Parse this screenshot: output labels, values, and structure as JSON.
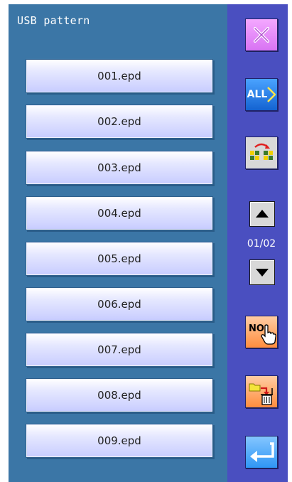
{
  "title": "USB pattern",
  "files": [
    {
      "label": "001.epd"
    },
    {
      "label": "002.epd"
    },
    {
      "label": "003.epd"
    },
    {
      "label": "004.epd"
    },
    {
      "label": "005.epd"
    },
    {
      "label": "006.epd"
    },
    {
      "label": "007.epd"
    },
    {
      "label": "008.epd"
    },
    {
      "label": "009.epd"
    }
  ],
  "pagination": {
    "indicator": "01/02"
  },
  "sidebar": {
    "all_label": "ALL",
    "no_label": "NO.",
    "buttons": [
      {
        "name": "close",
        "icon": "close-icon"
      },
      {
        "name": "select-all",
        "icon": "all-icon"
      },
      {
        "name": "swap-view",
        "icon": "grid-swap-icon"
      },
      {
        "name": "page-up",
        "icon": "triangle-up-icon"
      },
      {
        "name": "page-down",
        "icon": "triangle-down-icon"
      },
      {
        "name": "number-select",
        "icon": "hand-pointer-icon"
      },
      {
        "name": "move-to-trash",
        "icon": "folder-trash-icon"
      },
      {
        "name": "enter",
        "icon": "enter-arrow-icon"
      }
    ]
  },
  "colors": {
    "background": "#2d6fa1",
    "side_panel": "#4a4fc0",
    "file_button": "#d6daff",
    "close_button": "#e68ef8",
    "all_button": "#1e72e0",
    "no_button": "#ff9a52",
    "enter_button": "#4aa8ff"
  }
}
